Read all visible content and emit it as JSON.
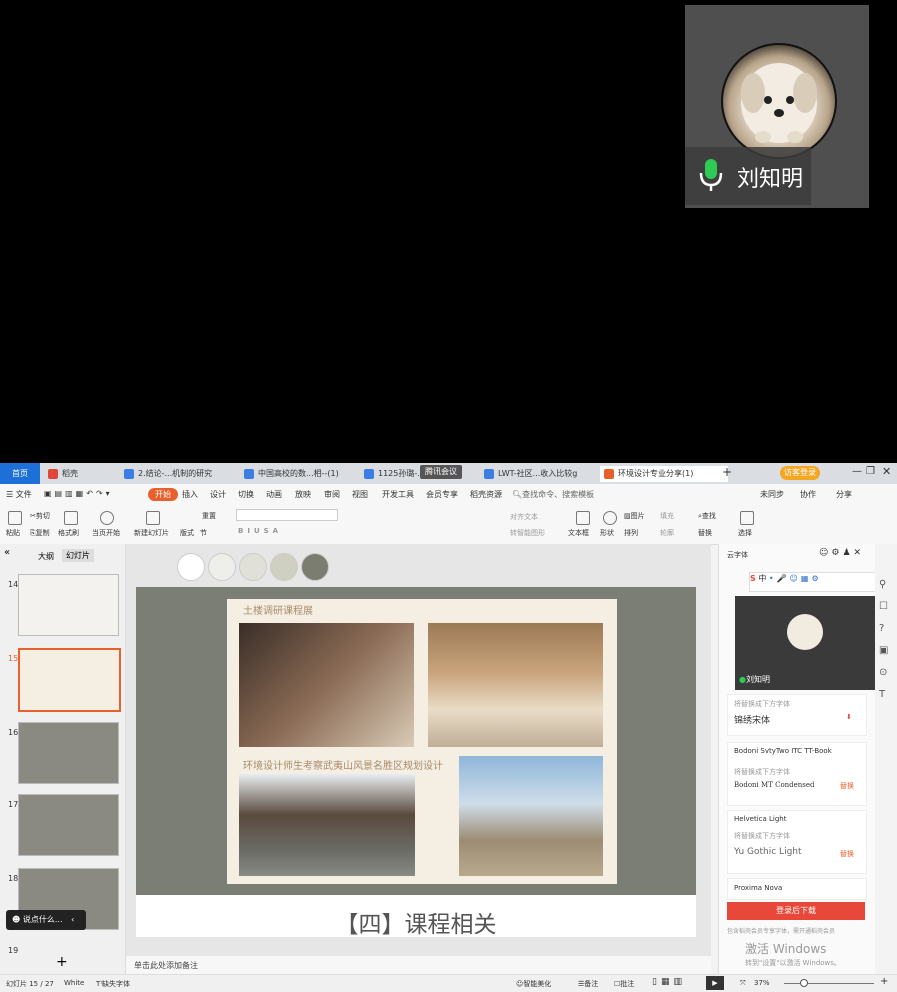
{
  "participant": {
    "name": "刘知明"
  },
  "tabs": [
    {
      "label": "首页"
    },
    {
      "label": "稻壳"
    },
    {
      "label": "2.结论-...机制的研究"
    },
    {
      "label": "中国高校的数...相--(1)"
    },
    {
      "label": "1125孙璐-...料"
    },
    {
      "label": "LWT-社区...收入比较g"
    },
    {
      "label": "环境设计专业分享(1)"
    }
  ],
  "meeting_badge": "腾讯会议",
  "login_badge": "访客登录",
  "menus": [
    "文件",
    "开始",
    "插入",
    "设计",
    "切换",
    "动画",
    "放映",
    "审阅",
    "视图",
    "开发工具",
    "会员专享",
    "稻壳资源"
  ],
  "search_placeholder": "查找命令、搜索模板",
  "top_actions": [
    "未同步",
    "协作",
    "分享"
  ],
  "ribbon": {
    "paste": "粘贴",
    "cut": "剪切",
    "copy": "复制",
    "format_painter": "格式刷",
    "from_current": "当页开始",
    "new_slide": "新建幻灯片",
    "layout": "版式",
    "section": "节",
    "reset": "重置",
    "text_box": "文本框",
    "shape": "形状",
    "arrange": "排列",
    "picture": "图片",
    "fill": "填充",
    "outline": "轮廓",
    "find": "查找",
    "replace": "替换",
    "select": "选择",
    "align_text": "对齐文本",
    "smart_art": "转智能图形"
  },
  "left_panel": {
    "tabs": [
      "大纲",
      "幻灯片"
    ],
    "slide_numbers": [
      "14",
      "15",
      "16",
      "17",
      "18",
      "19"
    ],
    "active": "15"
  },
  "swatch_colors": [
    "#ffffff",
    "#eeeeea",
    "#e0e0d8",
    "#cfcfc2",
    "#7a7d70"
  ],
  "slide": {
    "heading1": "土楼调研课程展",
    "heading2": "环境设计师生考察武夷山风景名胜区规划设计",
    "title": "【四】课程相关"
  },
  "notes_placeholder": "单击此处添加备注",
  "ask_bubble": "说点什么...",
  "right_panel": {
    "title": "云字体",
    "fonts": [
      {
        "name": "锦绣宋体",
        "tag": "将替换成下方字体"
      },
      {
        "name": "Bodoni SvtyTwo ITC TT-Book",
        "tag": "将替换成下方字体",
        "replacement": "Bodoni MT Condensed",
        "action": "替换"
      },
      {
        "name": "Helvetica Light",
        "tag": "将替换成下方字体",
        "replacement": "Yu Gothic Light",
        "action": "替换"
      },
      {
        "name": "Proxima Nova"
      }
    ],
    "login_button": "登录后下载",
    "footnote": "包含稻壳会员专享字体，需开通稻壳会员",
    "mini_name": "刘知明",
    "ime": "中"
  },
  "watermark": {
    "line1": "激活 Windows",
    "line2": "转到\"设置\"以激活 Windows。"
  },
  "status": {
    "slide_counter": "幻灯片 15 / 27",
    "theme": "White",
    "missing_font": "缺失字体",
    "smart_beautify": "智能美化",
    "notes": "备注",
    "comments": "批注",
    "zoom": "37%"
  }
}
